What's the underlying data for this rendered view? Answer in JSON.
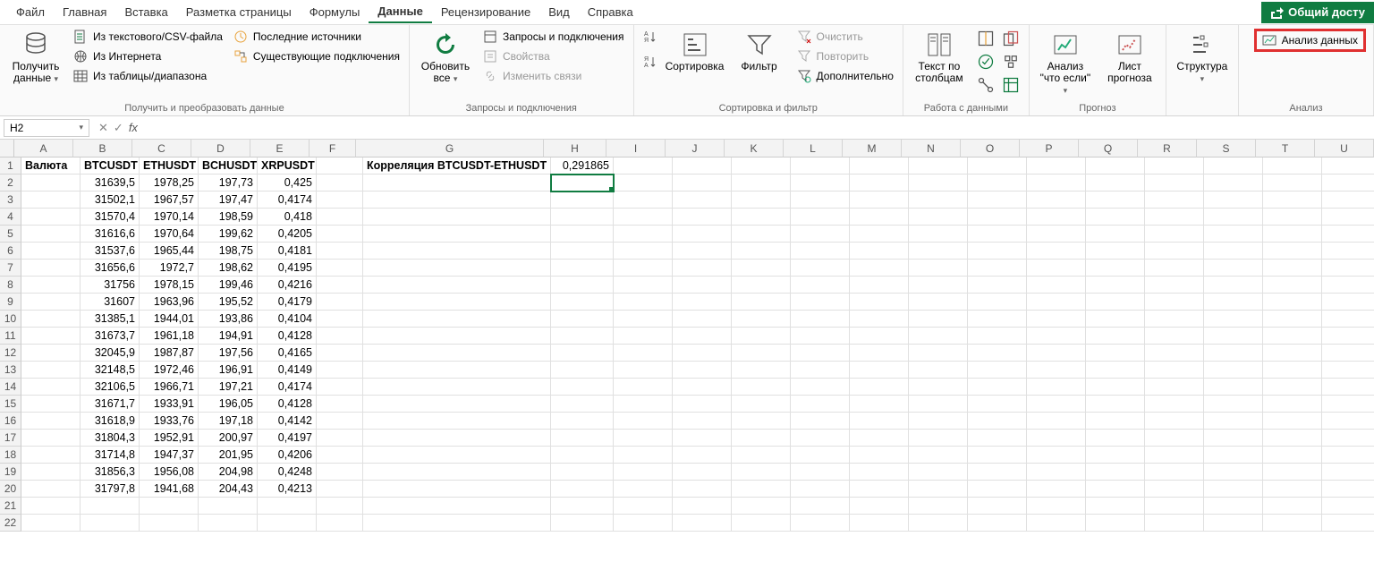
{
  "menubar": {
    "tabs": [
      "Файл",
      "Главная",
      "Вставка",
      "Разметка страницы",
      "Формулы",
      "Данные",
      "Рецензирование",
      "Вид",
      "Справка"
    ],
    "active_index": 5,
    "share": "Общий досту"
  },
  "ribbon": {
    "groups": {
      "get_transform": {
        "label": "Получить и преобразовать данные",
        "get_data": "Получить данные",
        "from_csv": "Из текстового/CSV-файла",
        "from_web": "Из Интернета",
        "from_table": "Из таблицы/диапазона",
        "recent": "Последние источники",
        "existing": "Существующие подключения"
      },
      "queries": {
        "label": "Запросы и подключения",
        "refresh": "Обновить все",
        "queries_conn": "Запросы и подключения",
        "properties": "Свойства",
        "edit_links": "Изменить связи"
      },
      "sort_filter": {
        "label": "Сортировка и фильтр",
        "sort": "Сортировка",
        "filter": "Фильтр",
        "clear": "Очистить",
        "reapply": "Повторить",
        "advanced": "Дополнительно"
      },
      "data_tools": {
        "label": "Работа с данными",
        "text_cols": "Текст по столбцам"
      },
      "forecast": {
        "label": "Прогноз",
        "whatif": "Анализ \"что если\"",
        "forecast_sheet": "Лист прогноза"
      },
      "outline": {
        "label": "",
        "structure": "Структура"
      },
      "analysis": {
        "label": "Анализ",
        "data_analysis": "Анализ данных"
      }
    }
  },
  "formula_bar": {
    "name_box": "H2",
    "formula": ""
  },
  "grid": {
    "col_widths": {
      "A": 66,
      "B": 66,
      "C": 66,
      "D": 66,
      "E": 66,
      "F": 52,
      "G": 210,
      "H": 70,
      "I": 66,
      "J": 66,
      "K": 66,
      "L": 66,
      "M": 66,
      "N": 66,
      "O": 66,
      "P": 66,
      "Q": 66,
      "R": 66,
      "S": 66,
      "T": 66,
      "U": 66
    },
    "columns": [
      "A",
      "B",
      "C",
      "D",
      "E",
      "F",
      "G",
      "H",
      "I",
      "J",
      "K",
      "L",
      "M",
      "N",
      "O",
      "P",
      "Q",
      "R",
      "S",
      "T",
      "U"
    ],
    "rows": 22,
    "selected": {
      "row": 2,
      "col": "H"
    },
    "headers": {
      "A": "Валюта",
      "B": "BTCUSDT",
      "C": "ETHUSDT",
      "D": "BCHUSDT",
      "E": "XRPUSDT"
    },
    "g1": "Корреляция BTCUSDT-ETHUSDT",
    "h1": "0,291865",
    "data": [
      [
        "31639,5",
        "1978,25",
        "197,73",
        "0,425"
      ],
      [
        "31502,1",
        "1967,57",
        "197,47",
        "0,4174"
      ],
      [
        "31570,4",
        "1970,14",
        "198,59",
        "0,418"
      ],
      [
        "31616,6",
        "1970,64",
        "199,62",
        "0,4205"
      ],
      [
        "31537,6",
        "1965,44",
        "198,75",
        "0,4181"
      ],
      [
        "31656,6",
        "1972,7",
        "198,62",
        "0,4195"
      ],
      [
        "31756",
        "1978,15",
        "199,46",
        "0,4216"
      ],
      [
        "31607",
        "1963,96",
        "195,52",
        "0,4179"
      ],
      [
        "31385,1",
        "1944,01",
        "193,86",
        "0,4104"
      ],
      [
        "31673,7",
        "1961,18",
        "194,91",
        "0,4128"
      ],
      [
        "32045,9",
        "1987,87",
        "197,56",
        "0,4165"
      ],
      [
        "32148,5",
        "1972,46",
        "196,91",
        "0,4149"
      ],
      [
        "32106,5",
        "1966,71",
        "197,21",
        "0,4174"
      ],
      [
        "31671,7",
        "1933,91",
        "196,05",
        "0,4128"
      ],
      [
        "31618,9",
        "1933,76",
        "197,18",
        "0,4142"
      ],
      [
        "31804,3",
        "1952,91",
        "200,97",
        "0,4197"
      ],
      [
        "31714,8",
        "1947,37",
        "201,95",
        "0,4206"
      ],
      [
        "31856,3",
        "1956,08",
        "204,98",
        "0,4248"
      ],
      [
        "31797,8",
        "1941,68",
        "204,43",
        "0,4213"
      ]
    ]
  }
}
